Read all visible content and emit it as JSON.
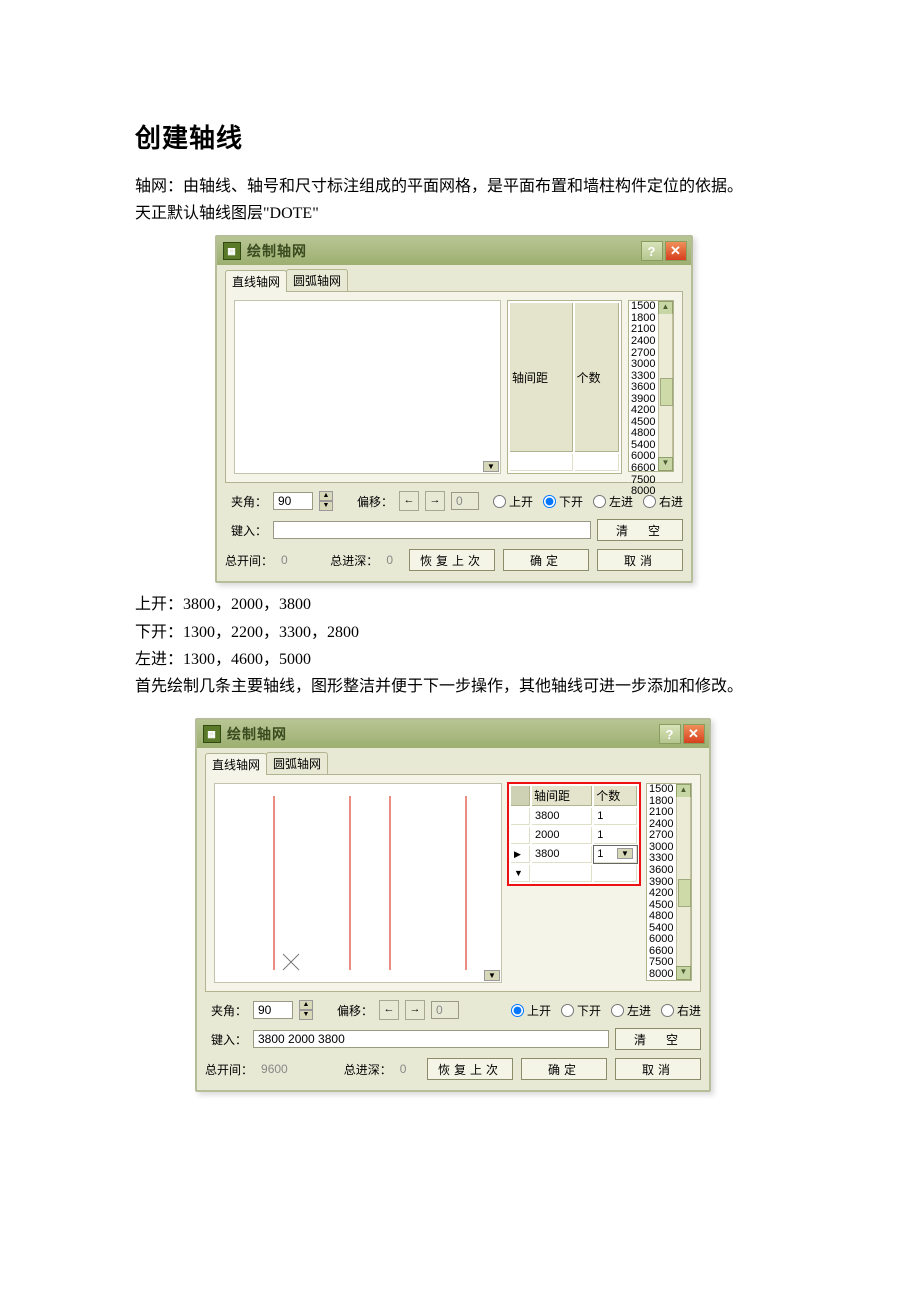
{
  "heading": "创建轴线",
  "intro_line1": "轴网：由轴线、轴号和尺寸标注组成的平面网格，是平面布置和墙柱构件定位的依据。",
  "intro_line2": "天正默认轴线图层\"DOTE\"",
  "dialog": {
    "title": "绘制轴网",
    "tabs": {
      "linear": "直线轴网",
      "arc": "圆弧轴网"
    },
    "col_spacing": "轴间距",
    "col_count": "个数",
    "presets": [
      "1500",
      "1800",
      "2100",
      "2400",
      "2700",
      "3000",
      "3300",
      "3600",
      "3900",
      "4200",
      "4500",
      "4800",
      "5400",
      "6000",
      "6600",
      "7500",
      "8000"
    ],
    "angle_label": "夹角：",
    "angle_value": "90",
    "offset_label": "偏移：",
    "offset_value": "0",
    "radio_up": "上开",
    "radio_down": "下开",
    "radio_left": "左进",
    "radio_right": "右进",
    "input_label": "键入：",
    "clear_btn": "清　空",
    "total_open_label": "总开间：",
    "total_depth_label": "总进深：",
    "restore_btn": "恢复上次",
    "ok_btn": "确定",
    "cancel_btn": "取消"
  },
  "dlg1": {
    "selected_radio": "down",
    "input_value": "",
    "total_open": "0",
    "total_depth": "0",
    "rows": []
  },
  "dlg2": {
    "selected_radio": "up",
    "input_value": "3800 2000 3800",
    "total_open": "9600",
    "total_depth": "0",
    "rows": [
      {
        "spacing": "3800",
        "count": "1"
      },
      {
        "spacing": "2000",
        "count": "1"
      },
      {
        "spacing": "3800",
        "count": "1",
        "active": true
      }
    ]
  },
  "mid_lines": {
    "l1": "上开：3800，2000，3800",
    "l2": "下开：1300，2200，3300，2800",
    "l3": "左进：1300，4600，5000",
    "l4": "首先绘制几条主要轴线，图形整洁并便于下一步操作，其他轴线可进一步添加和修改。"
  }
}
